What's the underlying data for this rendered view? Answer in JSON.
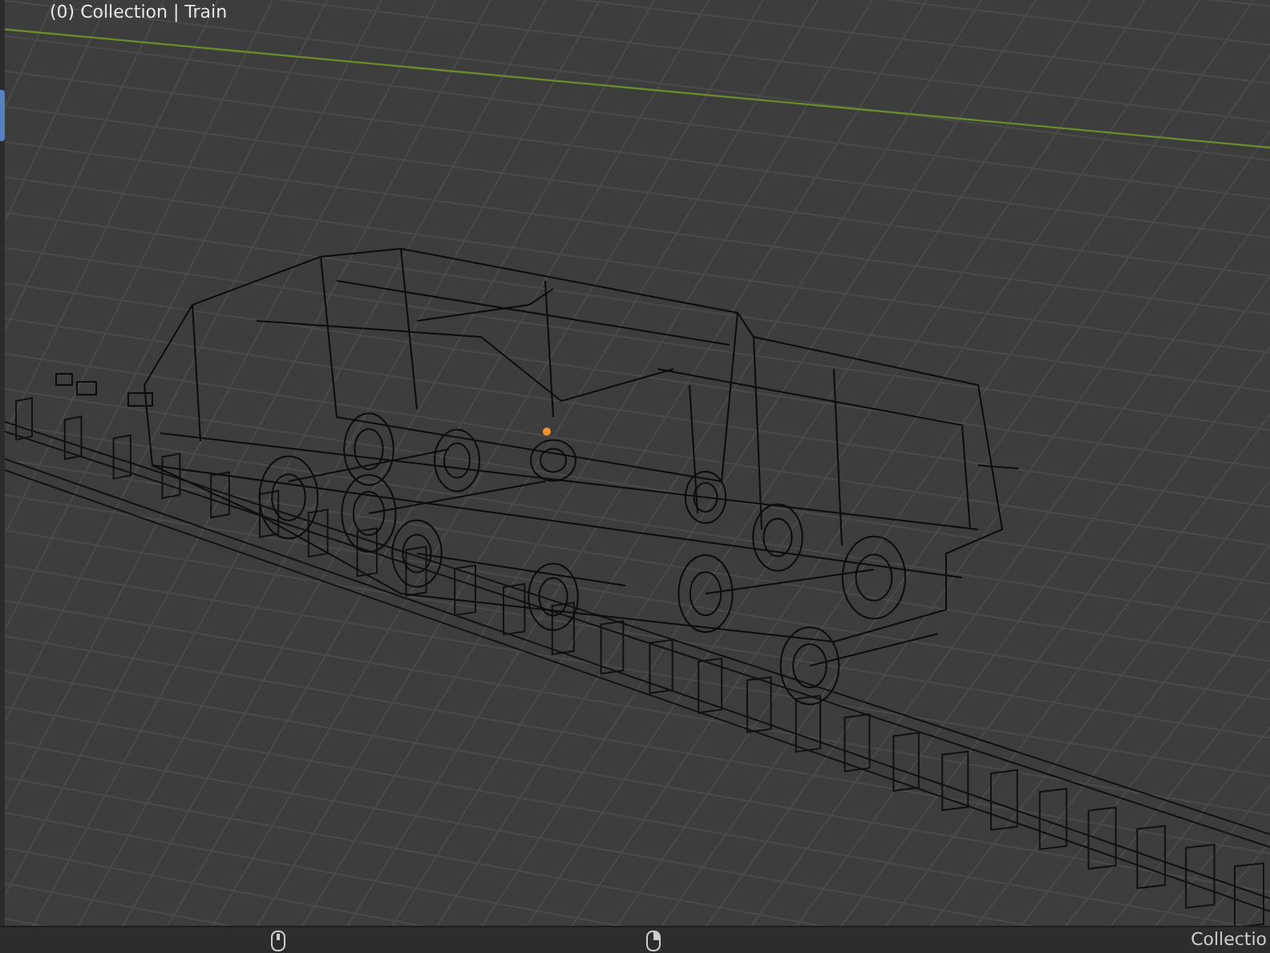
{
  "viewport": {
    "overlay_text": "(0) Collection | Train"
  },
  "status_bar": {
    "right_text": "Collectio"
  }
}
